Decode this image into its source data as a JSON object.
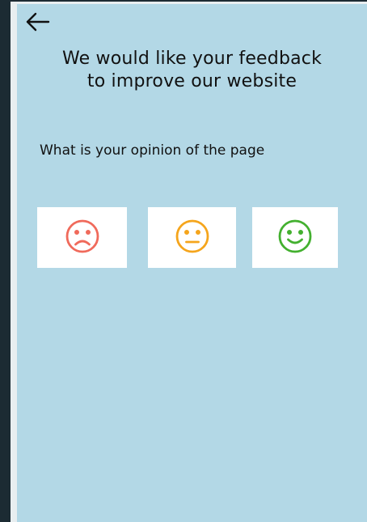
{
  "header": {
    "back_icon": "arrow-left-icon",
    "headline_line1": "We would like your feedback",
    "headline_line2": "to improve our website"
  },
  "survey": {
    "question": "What is your opinion of the page",
    "options": [
      {
        "icon": "sad-face-icon",
        "color": "#f06a5b"
      },
      {
        "icon": "neutral-face-icon",
        "color": "#f5a51c"
      },
      {
        "icon": "happy-face-icon",
        "color": "#43b02f"
      }
    ]
  },
  "colors": {
    "background": "#b3d8e6",
    "outer_frame": "#1c2b33",
    "button_background": "#ffffff"
  }
}
